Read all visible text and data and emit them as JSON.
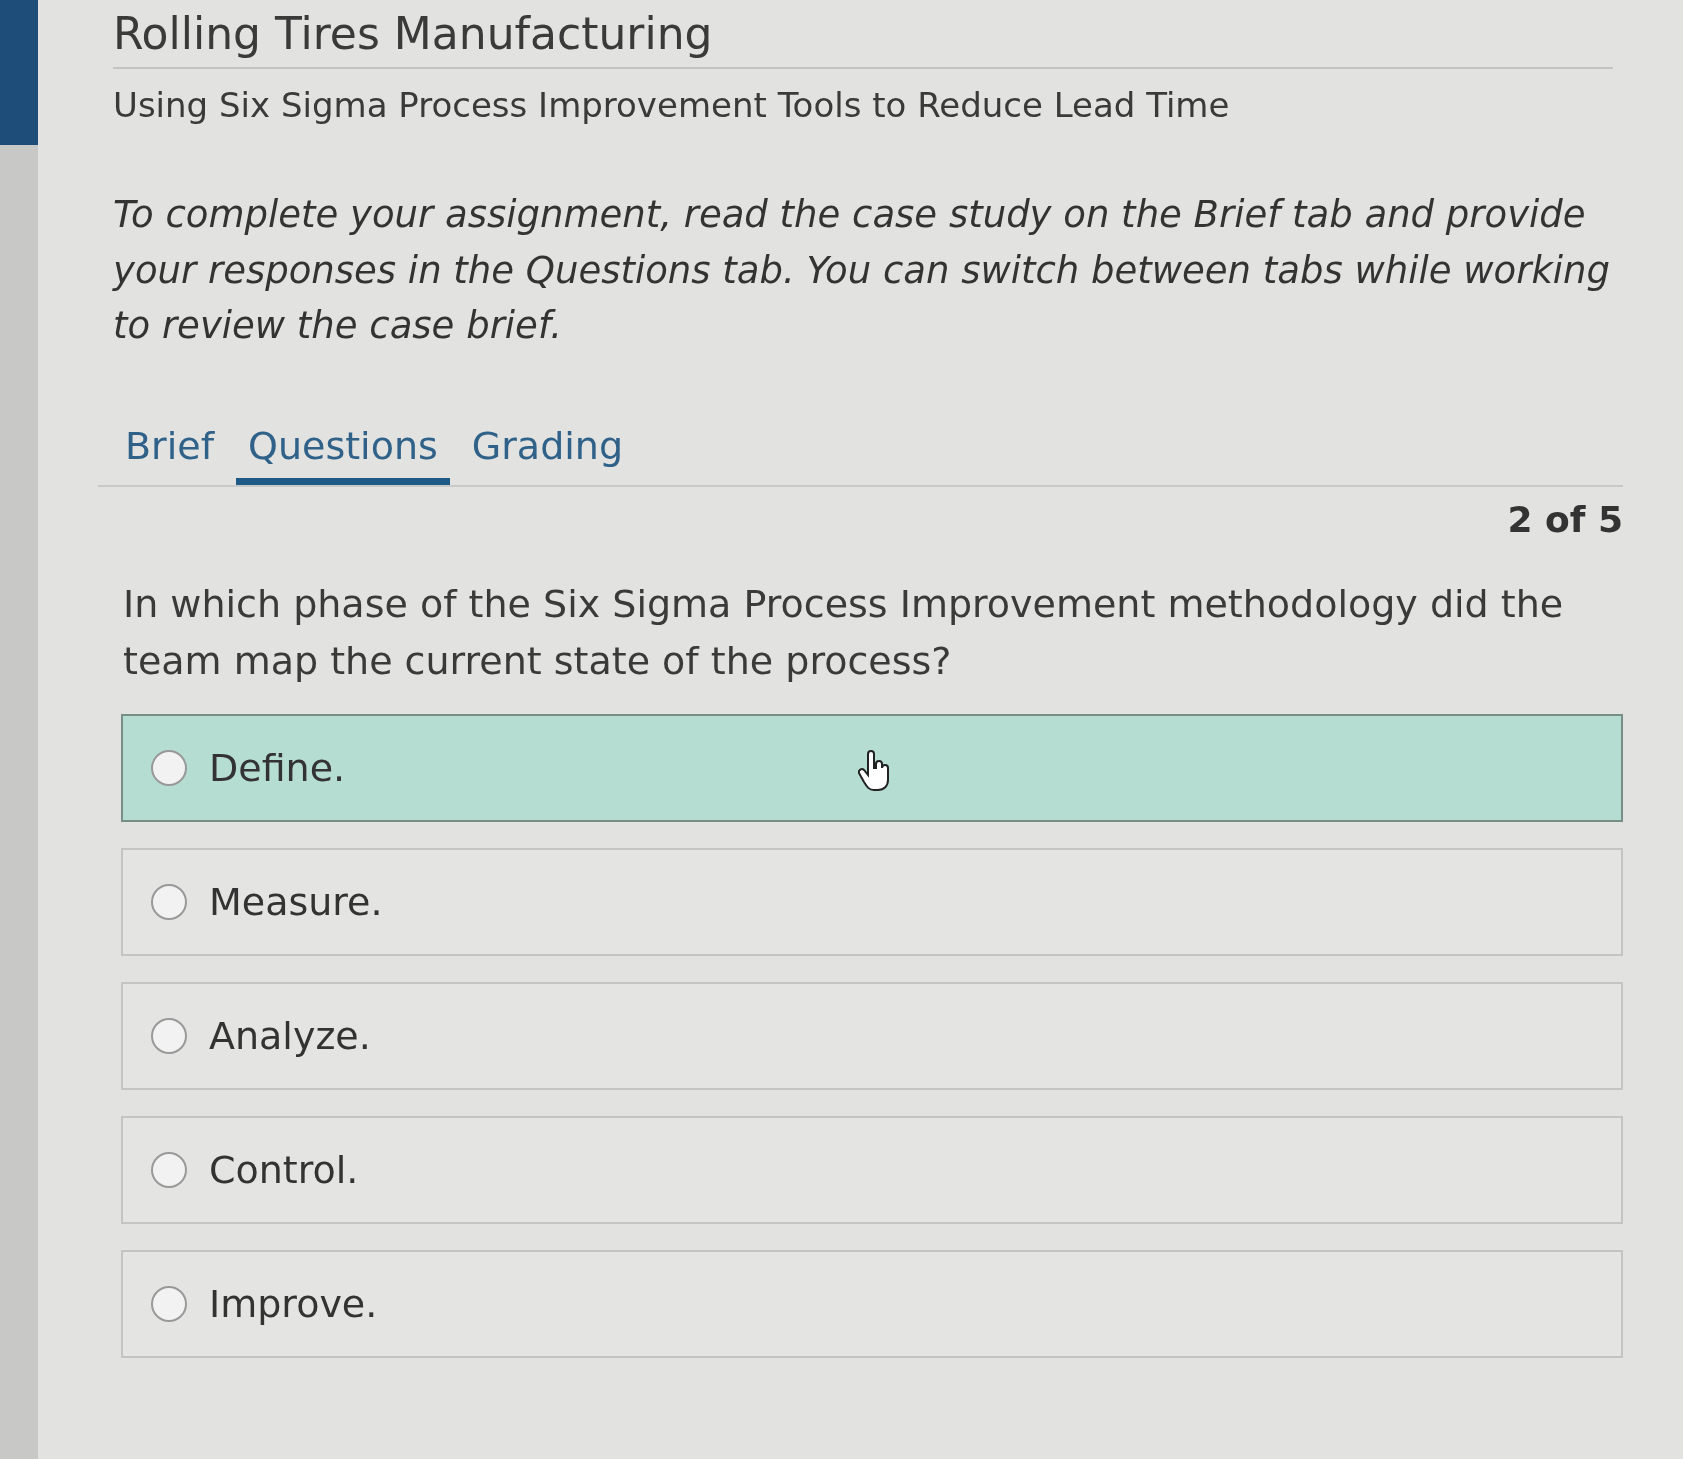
{
  "header": {
    "title": "Rolling Tires Manufacturing",
    "subtitle": "Using Six Sigma Process Improvement Tools to Reduce Lead Time"
  },
  "instructions": "To complete your assignment, read the case study on the Brief tab and provide your responses in the Questions tab. You can switch between tabs while working to review the case brief.",
  "tabs": [
    {
      "label": "Brief",
      "selected": false
    },
    {
      "label": "Questions",
      "selected": true
    },
    {
      "label": "Grading",
      "selected": false
    }
  ],
  "question": {
    "counter": "2 of 5",
    "text": "In which phase of the Six Sigma Process Improvement methodology did the team map the current state of the process?",
    "options": [
      {
        "label": "Define.",
        "selected": false,
        "highlighted": true
      },
      {
        "label": "Measure.",
        "selected": false,
        "highlighted": false
      },
      {
        "label": "Analyze.",
        "selected": false,
        "highlighted": false
      },
      {
        "label": "Control.",
        "selected": false,
        "highlighted": false
      },
      {
        "label": "Improve.",
        "selected": false,
        "highlighted": false
      }
    ]
  }
}
